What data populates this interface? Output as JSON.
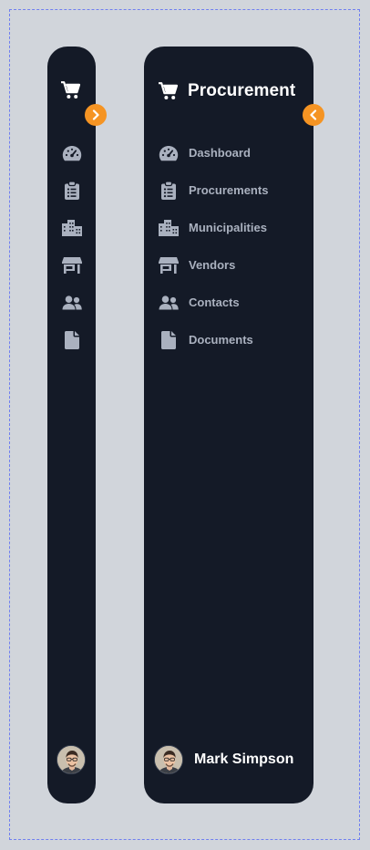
{
  "app": {
    "title": "Procurement"
  },
  "nav": [
    {
      "label": "Dashboard",
      "icon": "gauge-icon"
    },
    {
      "label": "Procurements",
      "icon": "clipboard-list-icon"
    },
    {
      "label": "Municipalities",
      "icon": "city-icon"
    },
    {
      "label": "Vendors",
      "icon": "store-icon"
    },
    {
      "label": "Contacts",
      "icon": "users-icon"
    },
    {
      "label": "Documents",
      "icon": "file-icon"
    }
  ],
  "user": {
    "name": "Mark Simpson"
  },
  "colors": {
    "background": "#d1d5db",
    "sidebar": "#141a27",
    "accent": "#f59423",
    "nav_text": "#aab1bf",
    "text": "#ffffff"
  }
}
